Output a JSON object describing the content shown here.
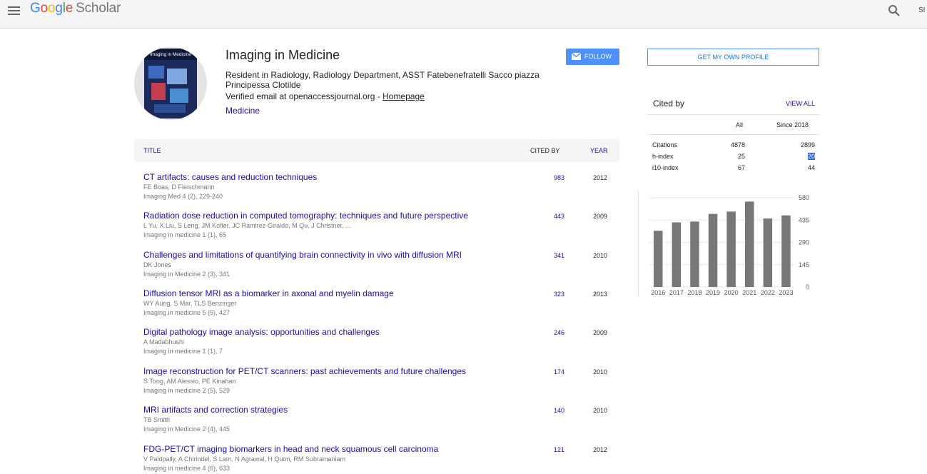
{
  "header": {
    "logo_google": [
      "G",
      "o",
      "o",
      "g",
      "l",
      "e"
    ],
    "logo_scholar": "Scholar",
    "signin": "SI"
  },
  "profile": {
    "name": "Imaging in Medicine",
    "affiliation": "Resident in Radiology, Radiology Department, ASST Fatebenefratelli Sacco piazza Principessa Clotilde",
    "email_prefix": "Verified email at openaccessjournal.org - ",
    "homepage": "Homepage",
    "interest": "Medicine",
    "avatar_text": "Imaging in Medicine",
    "follow_label": "FOLLOW"
  },
  "table": {
    "title_header": "TITLE",
    "cited_header": "CITED BY",
    "year_header": "YEAR",
    "rows": [
      {
        "title": "CT artifacts: causes and reduction techniques",
        "authors": "FE Boas, D Fleischmann",
        "venue": "Imaging Med 4 (2), 229-240",
        "cites": "983",
        "year": "2012"
      },
      {
        "title": "Radiation dose reduction in computed tomography: techniques and future perspective",
        "authors": "L Yu, X Liu, S Leng, JM Kofler, JC Ramirez-Giraldo, M Qu, J Christner, ...",
        "venue": "Imaging in medicine 1 (1), 65",
        "cites": "443",
        "year": "2009"
      },
      {
        "title": "Challenges and limitations of quantifying brain connectivity in vivo with diffusion MRI",
        "authors": "DK Jones",
        "venue": "Imaging in Medicine 2 (3), 341",
        "cites": "341",
        "year": "2010"
      },
      {
        "title": "Diffusion tensor MRI as a biomarker in axonal and myelin damage",
        "authors": "WY Aung, S Mar, TLS Benzinger",
        "venue": "Imaging in medicine 5 (5), 427",
        "cites": "323",
        "year": "2013"
      },
      {
        "title": "Digital pathology image analysis: opportunities and challenges",
        "authors": "A Madabhushi",
        "venue": "Imaging in medicine 1 (1), 7",
        "cites": "246",
        "year": "2009"
      },
      {
        "title": "Image reconstruction for PET/CT scanners: past achievements and future challenges",
        "authors": "S Tong, AM Alessio, PE Kinahan",
        "venue": "Imaging in medicine 2 (5), 529",
        "cites": "174",
        "year": "2010"
      },
      {
        "title": "MRI artifacts and correction strategies",
        "authors": "TB Smith",
        "venue": "Imaging in Medicine 2 (4), 445",
        "cites": "140",
        "year": "2010"
      },
      {
        "title": "FDG-PET/CT imaging biomarkers in head and neck squamous cell carcinoma",
        "authors": "V Paidpally, A Chirindel, S Lam, N Agrawal, H Quon, RM Subramaniam",
        "venue": "Imaging in medicine 4 (6), 633",
        "cites": "121",
        "year": "2012"
      }
    ]
  },
  "sidebar": {
    "get_profile": "GET MY OWN PROFILE",
    "cited_by": "Cited by",
    "view_all": "VIEW ALL",
    "col_all": "All",
    "col_since": "Since 2018",
    "stats": [
      {
        "label": "Citations",
        "all": "4878",
        "since": "2899"
      },
      {
        "label": "h-index",
        "all": "25",
        "since": "20"
      },
      {
        "label": "i10-index",
        "all": "67",
        "since": "44"
      }
    ]
  },
  "colors": {
    "link": "#1a0dab",
    "accent": "#4d90fe",
    "bar": "#777777"
  },
  "chart_data": {
    "type": "bar",
    "categories": [
      "2016",
      "2017",
      "2018",
      "2019",
      "2020",
      "2021",
      "2022",
      "2023"
    ],
    "values": [
      365,
      420,
      425,
      475,
      490,
      555,
      445,
      465
    ],
    "yticks": [
      "580",
      "435",
      "290",
      "145",
      "0"
    ],
    "ylim": [
      0,
      580
    ]
  }
}
